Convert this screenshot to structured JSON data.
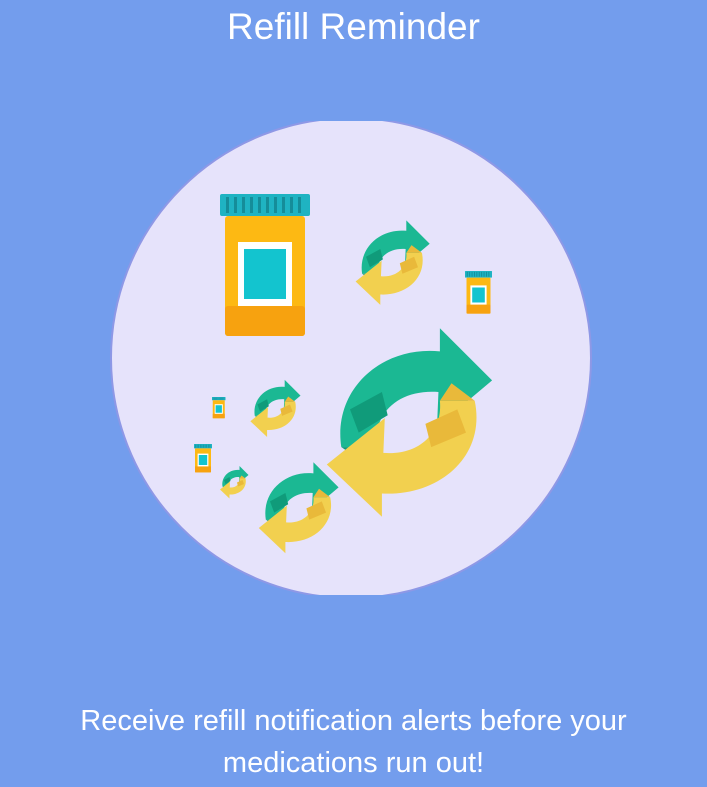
{
  "screen": {
    "title": "Refill Reminder",
    "description": "Receive refill notification alerts before your medications run out!"
  },
  "illustration": {
    "name": "refill-illustration",
    "icons": [
      "pill-bottle-icon",
      "refresh-arrows-icon"
    ]
  },
  "colors": {
    "background": "#739ded",
    "circle": "#e6e3fb",
    "circle_border": "#8e98e6",
    "bottle": "#fdb913",
    "bottle_shade": "#f7a20f",
    "cap": "#1fb3c2",
    "label": "#ffffff",
    "label_inner": "#13c4cf",
    "arrow_green": "#1bb893",
    "arrow_green_dark": "#109b7a",
    "arrow_yellow": "#f2d04f",
    "arrow_yellow_dark": "#e9b93a"
  }
}
